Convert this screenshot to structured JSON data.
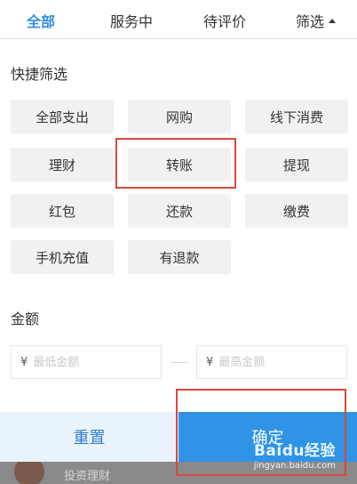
{
  "tabs": [
    {
      "label": "全部",
      "active": true
    },
    {
      "label": "服务中",
      "active": false
    },
    {
      "label": "待评价",
      "active": false
    },
    {
      "label": "筛选",
      "active": false
    }
  ],
  "quick_filter": {
    "title": "快捷筛选",
    "options": [
      "全部支出",
      "网购",
      "线下消费",
      "理财",
      "转账",
      "提现",
      "红包",
      "还款",
      "缴费",
      "手机充值",
      "有退款"
    ]
  },
  "amount": {
    "title": "金额",
    "currency_symbol": "¥",
    "min_placeholder": "最低金额",
    "max_placeholder": "最高金额"
  },
  "actions": {
    "reset_label": "重置",
    "confirm_label": "确定"
  },
  "background_peek": {
    "text": "投资理财"
  },
  "watermark": {
    "logo": "Baidu经验",
    "url": "jingyan.baidu.com"
  },
  "colors": {
    "accent": "#2f8ee0",
    "confirm_bg": "#2f93e6",
    "reset_bg": "#e9f3fc",
    "highlight": "#d9483b"
  }
}
